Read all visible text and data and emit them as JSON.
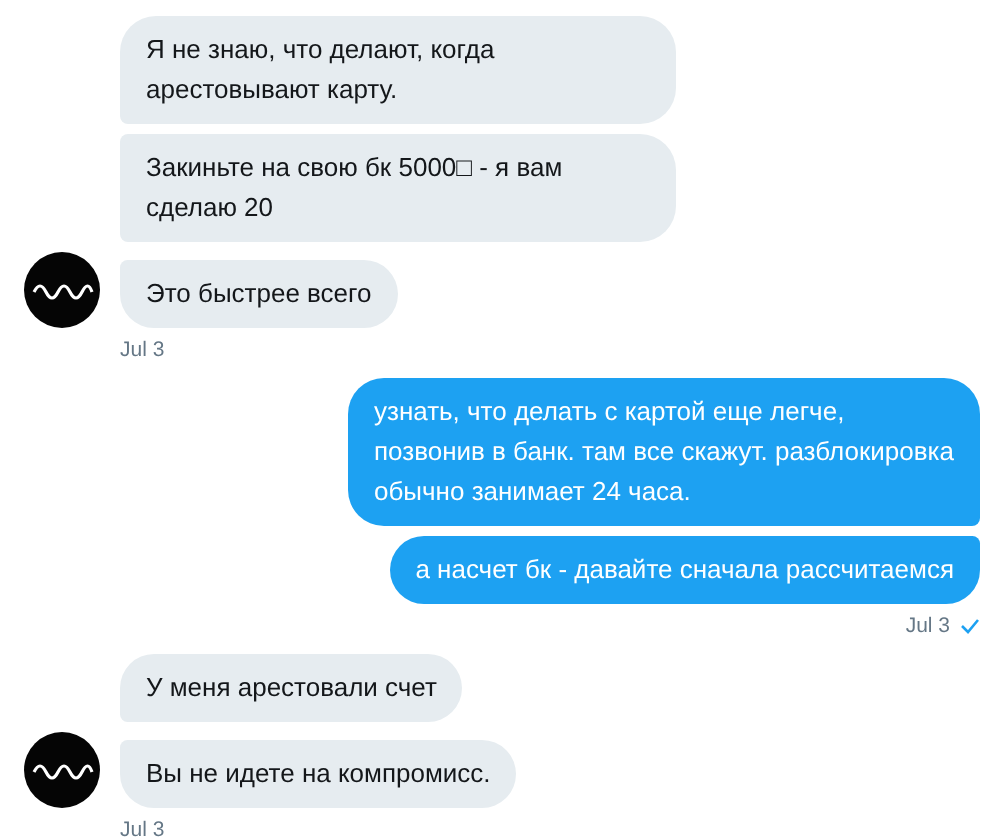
{
  "conversation": [
    {
      "kind": "incoming",
      "messages": [
        "Я не знаю, что делают, когда арестовывают карту.",
        "Закиньте на свою бк 5000□ - я вам сделаю 20",
        "Это быстрее всего"
      ],
      "time": "Jul 3",
      "checked": false
    },
    {
      "kind": "outgoing",
      "messages": [
        "узнать, что делать с картой еще легче, позвонив в банк. там все скажут. разблокировка обычно занимает 24 часа.",
        "а насчет бк - давайте сначала рассчитаемся"
      ],
      "time": "Jul 3",
      "checked": true
    },
    {
      "kind": "incoming",
      "messages": [
        "У меня арестовали счет",
        "Вы не идете на компромисс."
      ],
      "time": "Jul 3",
      "checked": false
    }
  ]
}
